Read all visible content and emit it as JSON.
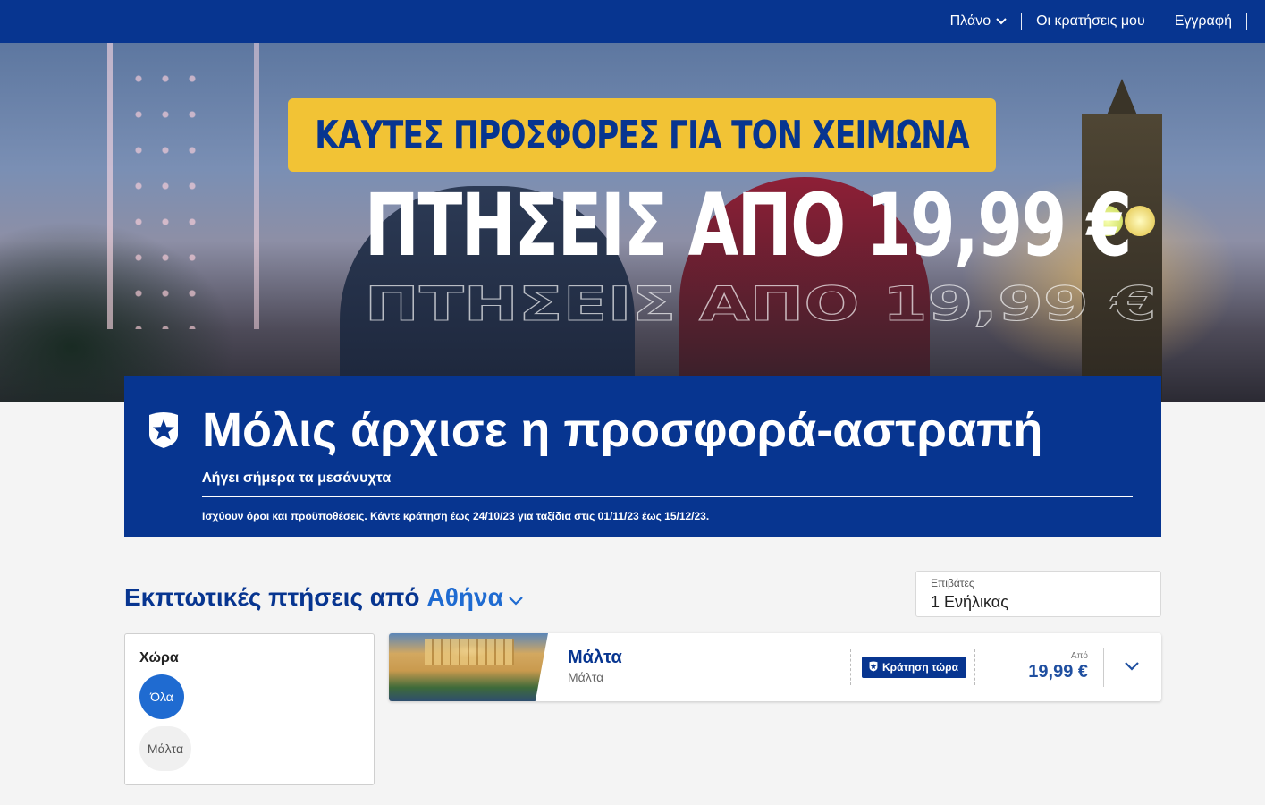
{
  "nav": {
    "plan_label": "Πλάνο",
    "bookings_label": "Οι κρατήσεις μου",
    "register_label": "Εγγραφή"
  },
  "hero": {
    "banner_text": "ΚΑΥΤΕΣ ΠΡΟΣΦΟΡΕΣ ΓΙΑ ΤΟΝ ΧΕΙΜΩΝΑ",
    "big_text": "ΠΤΗΣΕΙΣ ΑΠΟ 19,99 €"
  },
  "flash_sale": {
    "icon": "star-shield-icon",
    "title": "Μόλις άρχισε η προσφορά-αστραπή",
    "subtitle": "Λήγει σήμερα τα μεσάνυχτα",
    "terms": "Ισχύουν όροι και προϋποθέσεις. Κάντε κράτηση έως 24/10/23 για ταξίδια στις 01/11/23 έως 15/12/23."
  },
  "search": {
    "heading_prefix": "Εκπτωτικές πτήσεις από",
    "origin_city": "Αθήνα",
    "passengers_label": "Επιβάτες",
    "passengers_value": "1 Ενήλικας"
  },
  "filter": {
    "label": "Χώρα",
    "options": [
      "Όλα",
      "Μάλτα"
    ],
    "selected": "Όλα"
  },
  "results": [
    {
      "destination": "Μάλτα",
      "country": "Μάλτα",
      "book_label": "Κράτηση τώρα",
      "from_label": "Από",
      "price": "19,99 €"
    }
  ],
  "colors": {
    "primary": "#073590",
    "accent_blue": "#1f6bd1",
    "yellow": "#f2c335",
    "background": "#f4f4f4"
  }
}
